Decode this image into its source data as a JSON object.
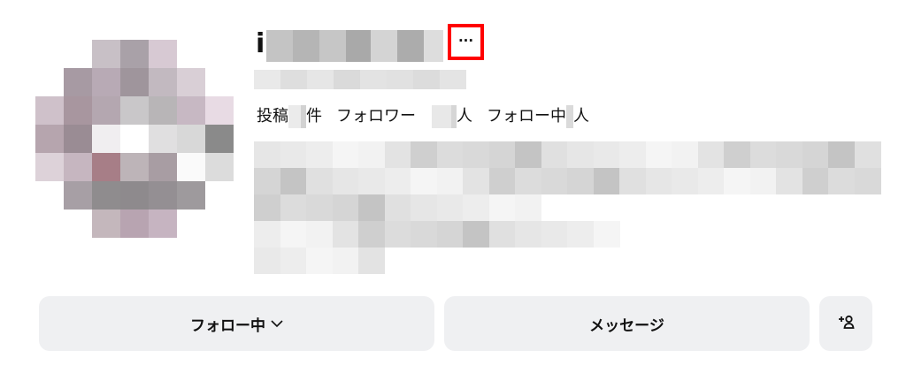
{
  "profile": {
    "username_visible_char": "i",
    "more_options_label": "···",
    "stats": {
      "posts_prefix": "投稿",
      "posts_suffix": "件",
      "followers_prefix": "フォロワー",
      "followers_suffix": "人",
      "following_prefix": "フォロー中",
      "following_suffix": "人"
    }
  },
  "actions": {
    "following_label": "フォロー中",
    "message_label": "メッセージ",
    "icons": {
      "following": "chevron-down-icon",
      "add_person": "add-person-icon"
    }
  }
}
